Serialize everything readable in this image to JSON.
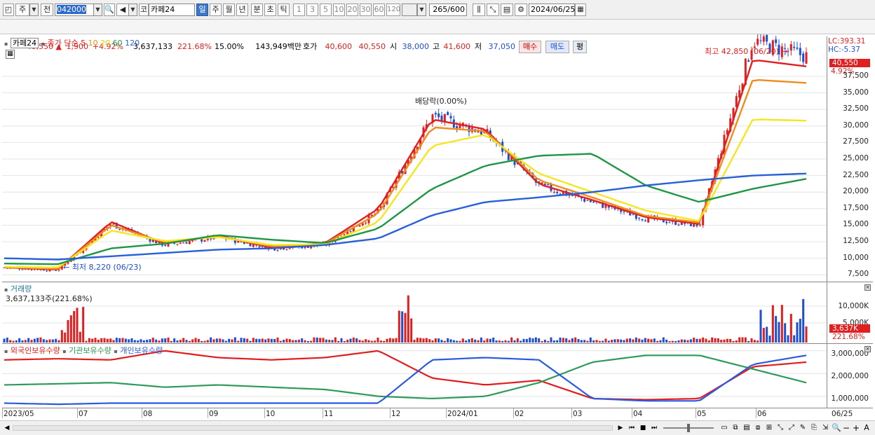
{
  "toolbar": {
    "market_label": "주",
    "prev_label": "전",
    "code_value": "042000",
    "name_prefix": "코",
    "name_value": "카페24",
    "periods": [
      "일",
      "주",
      "월",
      "년",
      "분",
      "초",
      "틱"
    ],
    "active_period": "일",
    "intervals": [
      "1",
      "3",
      "5",
      "10",
      "20",
      "30",
      "60",
      "120"
    ],
    "count_value": "265",
    "count_total": "/600",
    "date_value": "2024/06/25"
  },
  "quote": {
    "price": "40,550",
    "change": "1,900",
    "change_pct": "+4.92%",
    "volume": "3,637,133",
    "volume_ratio": "221.68%",
    "turnover_pct": "15.00%",
    "amount": "143,949백만",
    "ask_label": "호가",
    "ask_price": "40,600",
    "bid_price": "40,550",
    "open_label": "시",
    "open_price": "38,000",
    "high_label": "고",
    "high_price": "41,600",
    "low_label": "저",
    "low_price": "37,050",
    "buy_label": "매수",
    "sell_label": "매도",
    "eval_label": "평"
  },
  "price_panel": {
    "name": "카페24",
    "legend_title": "종가 단순",
    "ma_periods": [
      "5",
      "10",
      "20",
      "60",
      "120"
    ],
    "lc": "LC:393.31",
    "hc": "HC:-5.37",
    "last_price": "40,550",
    "last_change": "4.92%",
    "y_ticks": [
      "37,500",
      "35,000",
      "32,500",
      "30,000",
      "27,500",
      "25,000",
      "22,500",
      "20,000",
      "17,500",
      "15,000",
      "12,500",
      "10,000",
      "7,500"
    ],
    "high_note": "최고 42,850 (06/20)",
    "low_note": "최저 8,220 (06/23)",
    "dividend_note": "배당락(0.00%)"
  },
  "volume_panel": {
    "title": "거래량",
    "value": "3,637,133주(221.68%)",
    "y_ticks": [
      "10,000K",
      "5,000K"
    ],
    "last_value": "3,637K",
    "last_ratio": "221.68%"
  },
  "holding_panel": {
    "legends": [
      "외국인보유수량",
      "기관보유수량",
      "개인보유수량"
    ],
    "y_ticks": [
      "3,000,000",
      "2,000,000",
      "1,000,000"
    ]
  },
  "x_axis": {
    "labels": [
      "2023/05",
      "07",
      "08",
      "09",
      "10",
      "11",
      "12",
      "2024/01",
      "02",
      "03",
      "04",
      "05",
      "06"
    ],
    "last_label": "06/25"
  },
  "colors": {
    "up": "#e02020",
    "down": "#1f4fd0",
    "ma5": "#e02020",
    "ma10": "#f08c1e",
    "ma20": "#f5e61e",
    "ma60": "#1e9646",
    "ma120": "#2860d8",
    "foreign": "#e01e1e",
    "institution": "#2f9a5a",
    "individual": "#2a5ae0"
  },
  "chart_data": {
    "type": "candlestick",
    "x": [
      "2023/05",
      "2023/06/23",
      "2023/07",
      "2023/08",
      "2023/09",
      "2023/10",
      "2023/11",
      "2023/12",
      "2023/12/28",
      "2024/01",
      "2024/02",
      "2024/03",
      "2024/04",
      "2024/05",
      "2024/06/20",
      "2024/06/25"
    ],
    "close_approx": [
      8600,
      8220,
      15200,
      12000,
      13200,
      11500,
      12000,
      17000,
      31500,
      29000,
      21000,
      18500,
      16000,
      15000,
      42850,
      40550
    ],
    "ylim": [
      7000,
      43000
    ],
    "ma_series": [
      {
        "name": "5",
        "values": [
          8600,
          8300,
          15500,
          12200,
          13400,
          11600,
          12300,
          17500,
          31000,
          29500,
          21200,
          18800,
          16200,
          15200,
          40000,
          39000
        ]
      },
      {
        "name": "10",
        "values": [
          8650,
          8400,
          15000,
          12400,
          13300,
          11800,
          12200,
          16800,
          29800,
          29200,
          21800,
          19200,
          16400,
          15400,
          37000,
          36500
        ]
      },
      {
        "name": "20",
        "values": [
          8700,
          8600,
          14200,
          12600,
          13200,
          12000,
          12100,
          15500,
          27000,
          28700,
          22800,
          20000,
          17200,
          15600,
          31000,
          30800
        ]
      },
      {
        "name": "60",
        "values": [
          9200,
          9100,
          11500,
          12200,
          13500,
          12800,
          12300,
          14500,
          20500,
          24000,
          25500,
          25800,
          21000,
          18500,
          20500,
          22000
        ]
      },
      {
        "name": "120",
        "values": [
          10000,
          9800,
          10300,
          10800,
          11300,
          11500,
          12000,
          13000,
          16500,
          18500,
          19200,
          20000,
          21000,
          21800,
          22500,
          22800
        ]
      }
    ],
    "volume_ylim": [
      0,
      13000
    ],
    "volume_units": "K",
    "holdings": [
      {
        "name": "외국인보유수량",
        "values": [
          2600000,
          2650000,
          2600000,
          3000000,
          2700000,
          2600000,
          2700000,
          3000000,
          1800000,
          1500000,
          1700000,
          900000,
          850000,
          900000,
          2300000,
          2500000
        ]
      },
      {
        "name": "기관보유수량",
        "values": [
          1500000,
          1550000,
          1600000,
          1400000,
          1500000,
          1400000,
          1300000,
          1000000,
          900000,
          1000000,
          1600000,
          2500000,
          2800000,
          2800000,
          2200000,
          1600000
        ]
      },
      {
        "name": "개인보유수량",
        "values": [
          700000,
          650000,
          700000,
          700000,
          700000,
          700000,
          700000,
          700000,
          2600000,
          2700000,
          2600000,
          900000,
          800000,
          800000,
          2400000,
          2800000
        ]
      }
    ],
    "holdings_ylim": [
      500000,
      3300000
    ]
  }
}
